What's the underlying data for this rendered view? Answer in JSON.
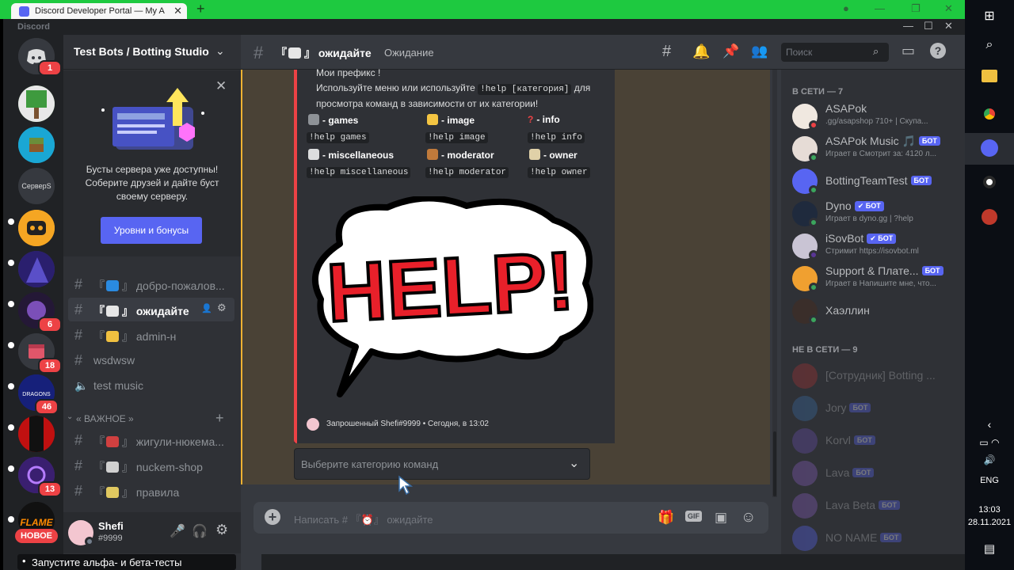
{
  "browser": {
    "tab_title": "Discord Developer Portal — My A",
    "tab_close": "✕",
    "new_tab": "+"
  },
  "app": {
    "name": "Discord"
  },
  "servers": {
    "home_badge": "1",
    "server_text": "СерверS",
    "badges": [
      "6",
      "18",
      "46",
      "13"
    ],
    "new_label": "НОВОЕ"
  },
  "sidebar": {
    "server_name": "Test Bots / Botting Studio",
    "promo_text": "Бусты сервера уже доступны! Соберите друзей и дайте буст своему серверу.",
    "promo_button": "Уровни и бонусы",
    "channels": [
      {
        "label": "добро-пожалов...",
        "type": "text"
      },
      {
        "label": "ожидайте",
        "type": "text"
      },
      {
        "label": "admin-н",
        "type": "text"
      },
      {
        "label": "wsdwsw",
        "type": "text"
      },
      {
        "label": "test music",
        "type": "voice"
      }
    ],
    "category": "« ВАЖНОЕ »",
    "category_channels": [
      {
        "label": "жигули-нюкема..."
      },
      {
        "label": "nuckem-shop"
      },
      {
        "label": "правила"
      }
    ],
    "bracket": "『",
    "bracket_close": "』"
  },
  "user": {
    "name": "Shefi",
    "tag": "#9999"
  },
  "chat": {
    "channel_name": "ожидайте",
    "topic": "Ожидание",
    "search_placeholder": "Поиск",
    "embed_prefix": "Мои префикс  !",
    "embed_desc_1": "Используйте меню или используйте",
    "embed_code": "!help [категория]",
    "embed_desc_2": "для",
    "embed_desc_3": "просмотра команд в зависимости от их категории!",
    "categories": [
      {
        "label": "- games",
        "code": "!help games",
        "color": "#b9bbbe"
      },
      {
        "label": "- image",
        "code": "!help image",
        "color": "#f4c542"
      },
      {
        "label": "- info",
        "code": "!help info",
        "color": "#ed4245"
      },
      {
        "label": "- miscellaneous",
        "code": "!help miscellaneous",
        "color": "#dcddde"
      },
      {
        "label": "- moderator",
        "code": "!help moderator",
        "color": "#c07a3b"
      },
      {
        "label": "- owner",
        "code": "!help owner",
        "color": "#e0d1a8"
      }
    ],
    "help_image_text": "HELP!",
    "footer": "Запрошенный Shefi#9999 • Сегодня, в 13:02",
    "select_placeholder": "Выберите категорию команд",
    "input_placeholder": "Написать # 『⏰』 ожидайте"
  },
  "members": {
    "online_header": "В СЕТИ — 7",
    "offline_header": "НЕ В СЕТИ — 9",
    "bot_label": "БОТ",
    "online": [
      {
        "name": "ASAPok",
        "status": ".gg/asapshop 710+ | Скупа...",
        "bot": false,
        "dot": "#ed4245",
        "color": "#f0e8e0"
      },
      {
        "name": "ASAPok Music 🎵",
        "status": "Играет в Смотрит за: 4120 л...",
        "bot": true,
        "dot": "#3ba55d",
        "color": "#e6dcd6"
      },
      {
        "name": "BottingTeamTest",
        "status": "",
        "bot": true,
        "dot": "#3ba55d",
        "color": "#5865f2"
      },
      {
        "name": "Dyno",
        "status": "Играет в dyno.gg | ?help",
        "bot": true,
        "verified": true,
        "dot": "#3ba55d",
        "color": "#1f2a3d"
      },
      {
        "name": "iSovBot",
        "status": "Стримит https://isovbot.ml",
        "bot": true,
        "verified": true,
        "dot": "#593695",
        "color": "#c9c4d4"
      },
      {
        "name": "Support & Плате...",
        "status": "Играет в Напишите мне, что...",
        "bot": true,
        "dot": "#3ba55d",
        "color": "#f0a030"
      },
      {
        "name": "Хаэллин",
        "status": "",
        "bot": false,
        "dot": "#3ba55d",
        "color": "#3a2e2a"
      }
    ],
    "offline": [
      {
        "name": "[Сотрудник] Botting ...",
        "bot": false,
        "color": "#a33"
      },
      {
        "name": "Jory",
        "bot": true,
        "color": "#3a6ea5"
      },
      {
        "name": "Korvl",
        "bot": true,
        "color": "#6a4fb0"
      },
      {
        "name": "Lava",
        "bot": true,
        "color": "#8a5fc0"
      },
      {
        "name": "Lava Beta",
        "bot": true,
        "color": "#8a5fc0"
      },
      {
        "name": "NO NAME",
        "bot": true,
        "color": "#5865f2"
      }
    ]
  },
  "notification": {
    "text": "Запустите альфа- и бета-тесты"
  },
  "taskbar": {
    "lang": "ENG",
    "time": "13:03",
    "date": "28.11.2021"
  }
}
